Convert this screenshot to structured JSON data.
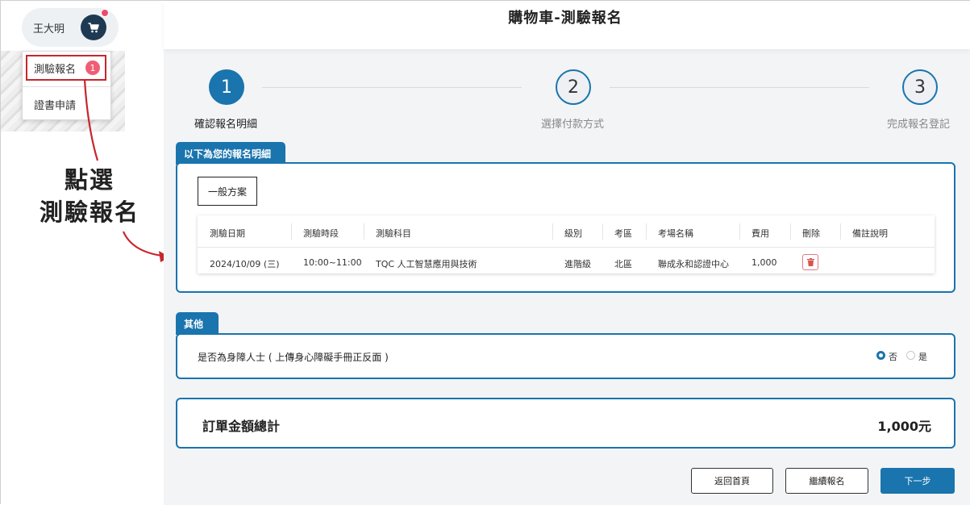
{
  "user": {
    "name": "王大明"
  },
  "menu": {
    "item1": "測驗報名",
    "item1_badge": "1",
    "item2": "證書申請"
  },
  "annotation": {
    "line1": "點選",
    "line2": "測驗報名"
  },
  "page_title": "購物車-測驗報名",
  "steps": [
    {
      "number": "1",
      "label": "確認報名明細"
    },
    {
      "number": "2",
      "label": "選擇付款方式"
    },
    {
      "number": "3",
      "label": "完成報名登記"
    }
  ],
  "details": {
    "tab": "以下為您的報名明細",
    "plan": "一般方案",
    "headers": [
      "測驗日期",
      "測驗時段",
      "測驗科目",
      "級別",
      "考區",
      "考場名稱",
      "費用",
      "刪除",
      "備註說明"
    ],
    "row": {
      "date": "2024/10/09 (三)",
      "time": "10:00~11:00",
      "subject": "TQC 人工智慧應用與技術",
      "level": "進階級",
      "area": "北區",
      "venue": "聯成永和認證中心",
      "fee": "1,000",
      "note": ""
    }
  },
  "other": {
    "tab": "其他",
    "question": "是否為身障人士 ( 上傳身心障礙手冊正反面 )",
    "options": [
      "否",
      "是"
    ],
    "selected": "否"
  },
  "total": {
    "label": "訂單金額總計",
    "amount": "1,000元"
  },
  "buttons": {
    "home": "返回首頁",
    "continue": "繼續報名",
    "next": "下一步"
  },
  "colors": {
    "primary": "#1a74ad",
    "annotation_red": "#c8252c",
    "badge": "#ee5f74"
  }
}
